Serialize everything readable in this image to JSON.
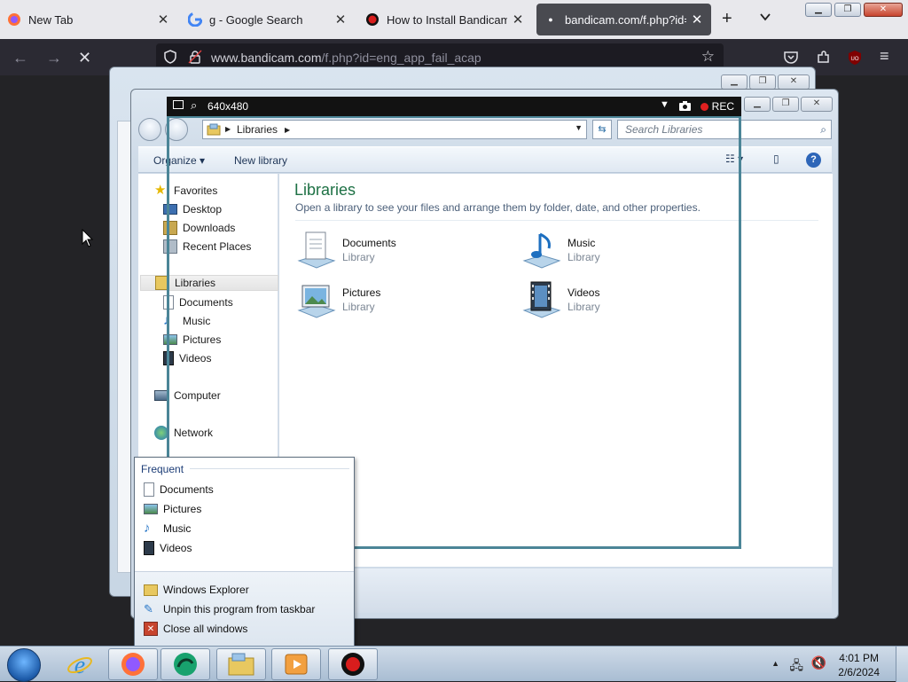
{
  "browser": {
    "tabs": [
      {
        "title": "New Tab",
        "icon": "firefox-icon"
      },
      {
        "title": "g - Google Search",
        "icon": "google-icon"
      },
      {
        "title": "How to Install Bandicam S",
        "icon": "bandicam-icon"
      },
      {
        "title": "bandicam.com/f.php?id=e",
        "icon": "page-icon"
      }
    ],
    "active_tab": 3,
    "url_host": "www.bandicam.com",
    "url_path": "/f.php?id=eng_app_fail_acap"
  },
  "bandicam": {
    "resolution": "640x480",
    "rec_label": "REC",
    "accent": "#4b8597"
  },
  "explorer": {
    "address": "Libraries",
    "search_placeholder": "Search Libraries",
    "toolbar": {
      "organize": "Organize",
      "new_library": "New library"
    },
    "nav": {
      "favorites": "Favorites",
      "favorites_items": [
        "Desktop",
        "Downloads",
        "Recent Places"
      ],
      "libraries": "Libraries",
      "libraries_items": [
        "Documents",
        "Music",
        "Pictures",
        "Videos"
      ],
      "computer": "Computer",
      "network": "Network"
    },
    "content": {
      "title": "Libraries",
      "subtitle": "Open a library to see your files and arrange them by folder, date, and other properties.",
      "libraries": [
        {
          "name": "Documents",
          "type": "Library"
        },
        {
          "name": "Music",
          "type": "Library"
        },
        {
          "name": "Pictures",
          "type": "Library"
        },
        {
          "name": "Videos",
          "type": "Library"
        }
      ]
    }
  },
  "jumplist": {
    "header": "Frequent",
    "frequent": [
      "Documents",
      "Pictures",
      "Music",
      "Videos"
    ],
    "tasks": [
      "Windows Explorer",
      "Unpin this program from taskbar",
      "Close all windows"
    ]
  },
  "taskbar": {
    "time": "4:01 PM",
    "date": "2/6/2024"
  }
}
